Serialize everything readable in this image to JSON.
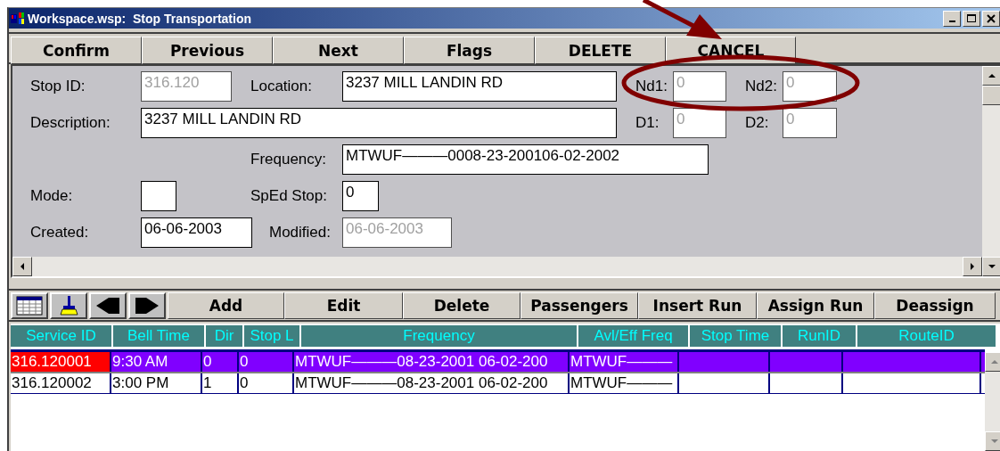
{
  "window": {
    "title": "Workspace.wsp:  Stop Transportation"
  },
  "toolbar": {
    "buttons": [
      "Confirm",
      "Previous",
      "Next",
      "Flags",
      "DELETE",
      "CANCEL"
    ]
  },
  "form": {
    "fields": [
      {
        "label": "Stop ID:",
        "value": "316.120",
        "disabled": true
      },
      {
        "label": "Location:",
        "value": "3237 MILL LANDIN RD",
        "disabled": false
      },
      {
        "label": "Nd1:",
        "value": "0",
        "disabled": true
      },
      {
        "label": "Nd2:",
        "value": "0",
        "disabled": true
      },
      {
        "label": "Description:",
        "value": "3237 MILL LANDIN RD",
        "disabled": false
      },
      {
        "label": "D1:",
        "value": "0",
        "disabled": true
      },
      {
        "label": "D2:",
        "value": "0",
        "disabled": true
      },
      {
        "label": "Frequency:",
        "value": "MTWUF———0008-23-200106-02-2002",
        "disabled": false
      },
      {
        "label": "Mode:",
        "disabled": false
      },
      {
        "label": "SpEd Stop:",
        "value": "0",
        "disabled": false
      },
      {
        "label": "Created:",
        "value": "06-06-2003",
        "disabled": false
      },
      {
        "label": "Modified:",
        "value": "06-06-2003",
        "disabled": true
      }
    ]
  },
  "grid_toolbar": {
    "icon_buttons": [
      {
        "kind": "grid"
      },
      {
        "kind": "brush"
      },
      {
        "kind": "prev"
      },
      {
        "kind": "next"
      }
    ],
    "buttons": [
      "Add",
      "Edit",
      "Delete",
      "Passengers",
      "Insert Run",
      "Assign Run",
      "Deassign"
    ]
  },
  "table": {
    "columns": [
      "Service ID",
      "Bell Time",
      "Dir",
      "Stop L",
      "Frequency",
      "Avl/Eff Freq",
      "Stop Time",
      "RunID",
      "RouteID"
    ],
    "rows": [
      {
        "selected": true,
        "cells": [
          "316.120001",
          "9:30 AM",
          "0",
          "0",
          "MTWUF———08-23-2001 06-02-200",
          "MTWUF———",
          "",
          "",
          ""
        ]
      },
      {
        "selected": false,
        "cells": [
          "316.120002",
          "3:00 PM",
          "1",
          "0",
          "MTWUF———08-23-2001 06-02-200",
          "MTWUF———",
          "",
          "",
          ""
        ]
      }
    ]
  }
}
